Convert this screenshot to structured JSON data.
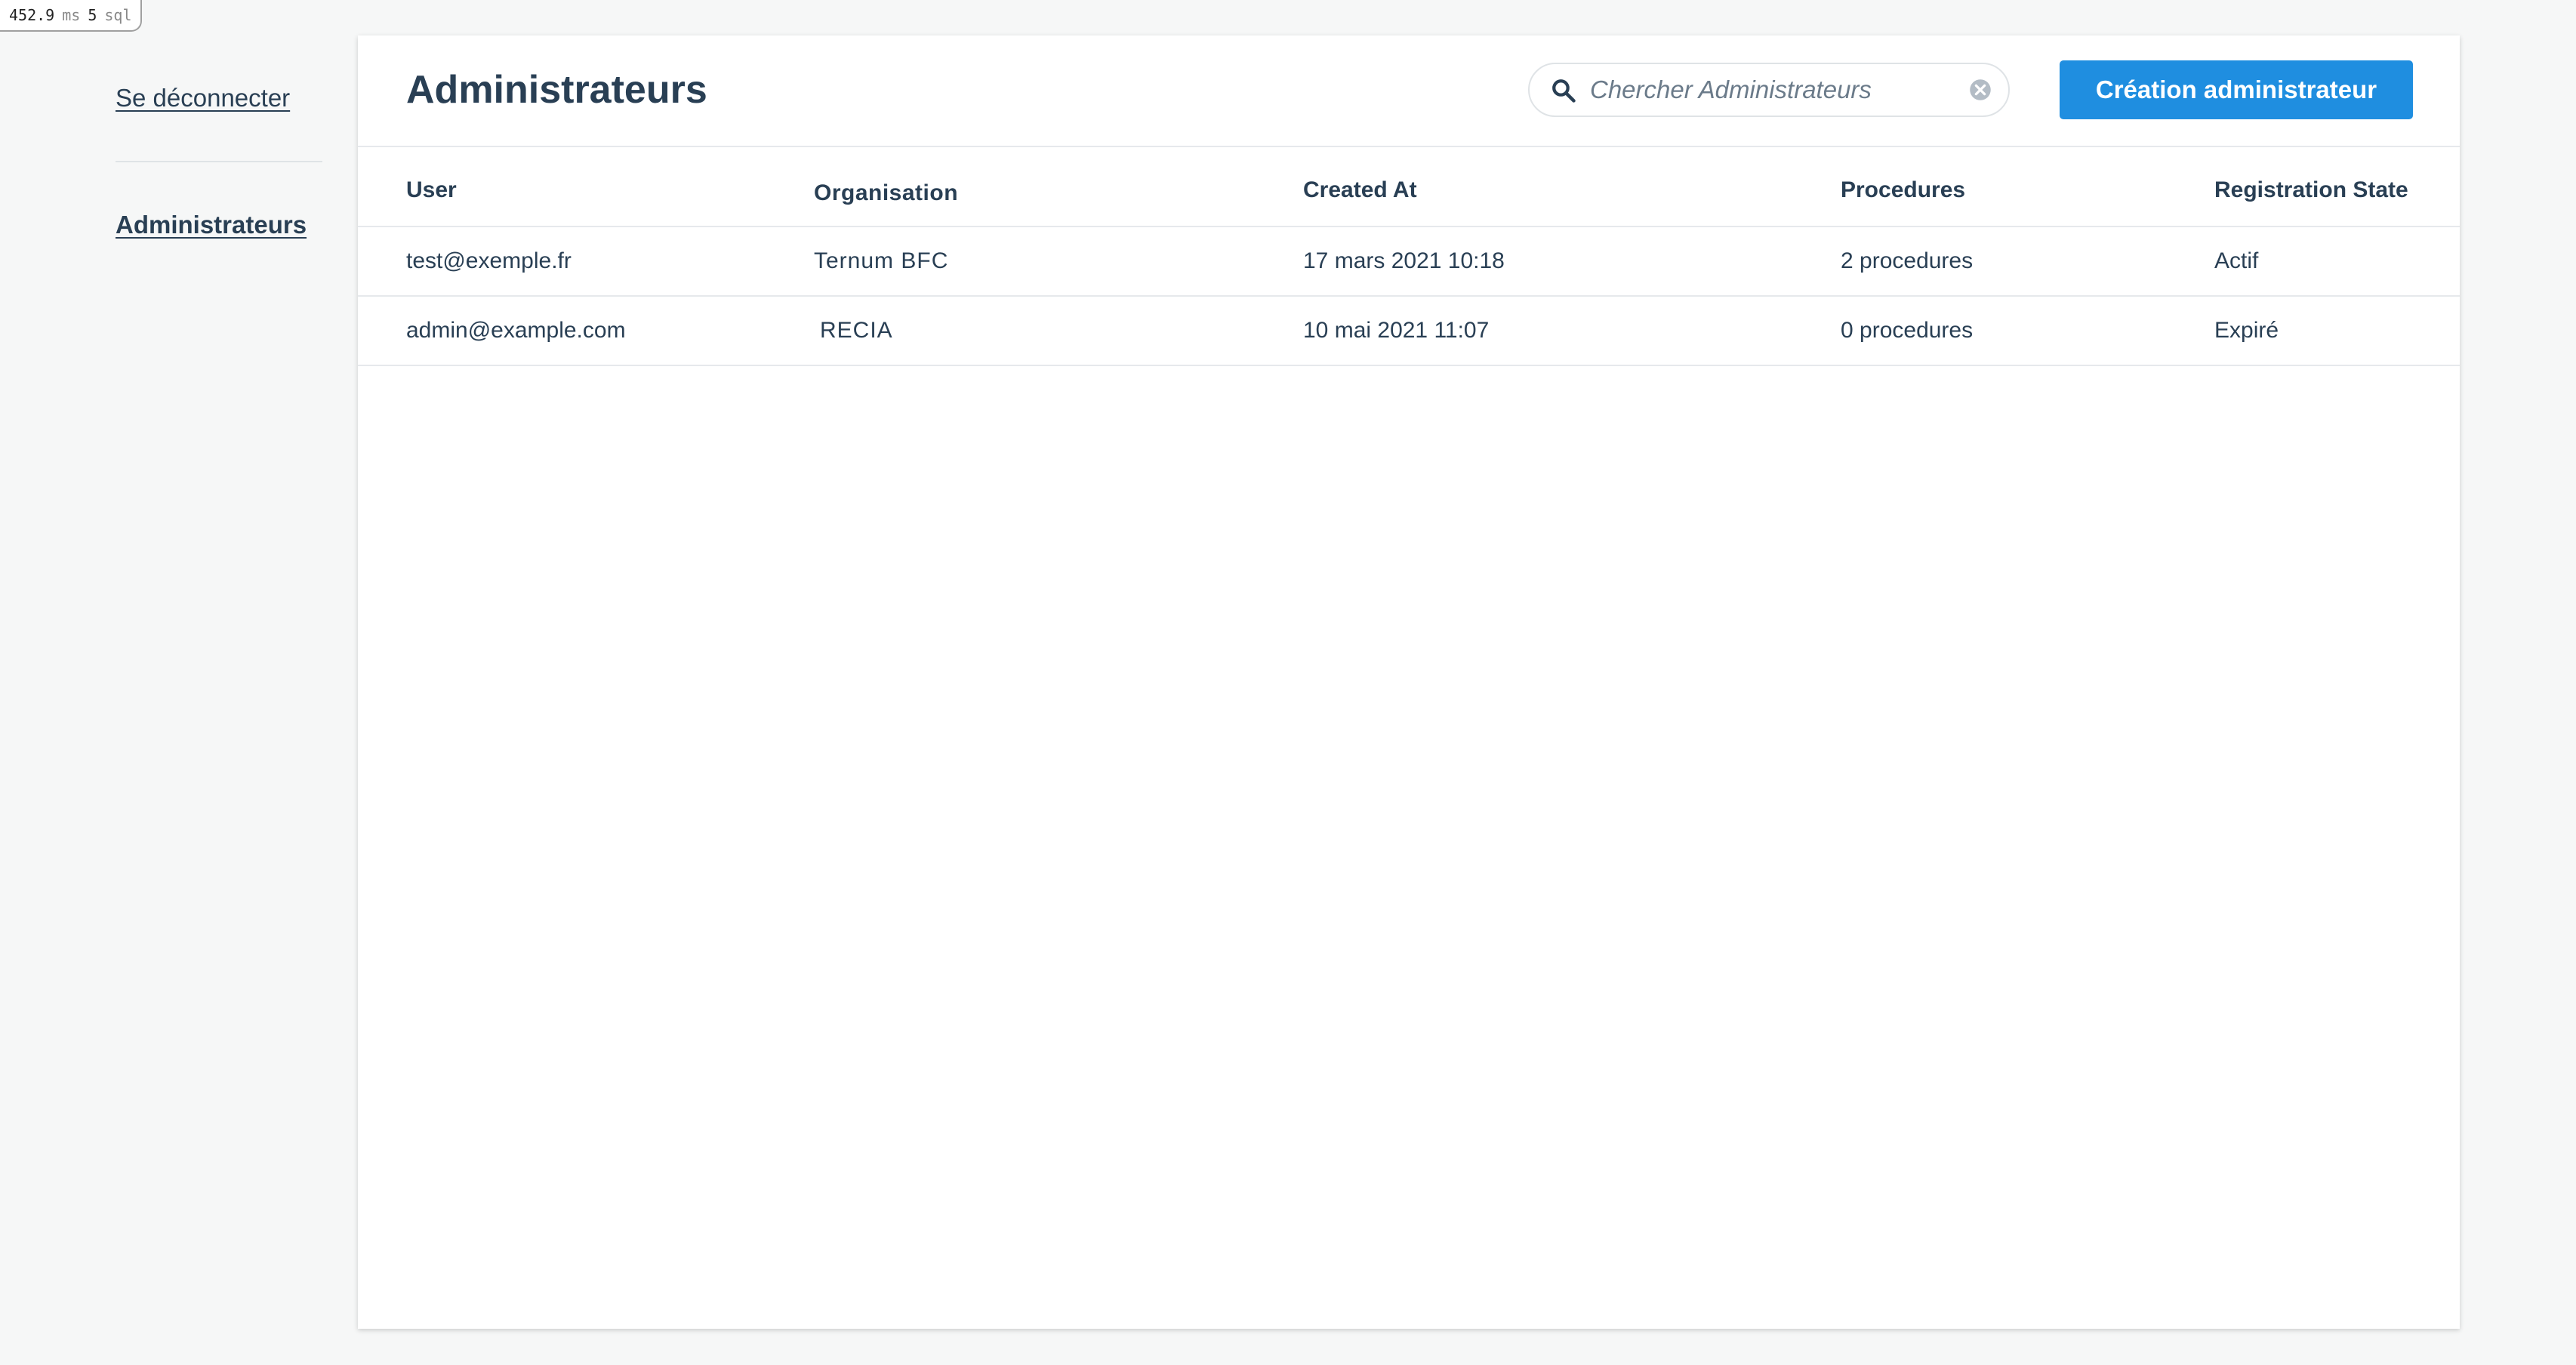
{
  "profiler": {
    "time": "452.9",
    "time_unit": "ms",
    "sql_count": "5",
    "sql_label": "sql"
  },
  "sidebar": {
    "logout_label": "Se déconnecter",
    "items": [
      {
        "label": "Administrateurs",
        "active": true
      }
    ]
  },
  "header": {
    "title": "Administrateurs",
    "search_placeholder": "Chercher Administrateurs",
    "search_value": "",
    "create_label": "Création administrateur"
  },
  "colors": {
    "accent": "#1f8ee0",
    "text": "#293f54",
    "background": "#f6f7f7"
  },
  "table": {
    "columns": [
      "User",
      "Organisation",
      "Created At",
      "Procedures",
      "Registration State"
    ],
    "rows": [
      [
        "test@exemple.fr",
        "Ternum BFC",
        "17 mars 2021 10:18",
        "2 procedures",
        "Actif"
      ],
      [
        "admin@example.com",
        "RECIA",
        "10 mai 2021 11:07",
        "0 procedures",
        "Expiré"
      ]
    ]
  }
}
